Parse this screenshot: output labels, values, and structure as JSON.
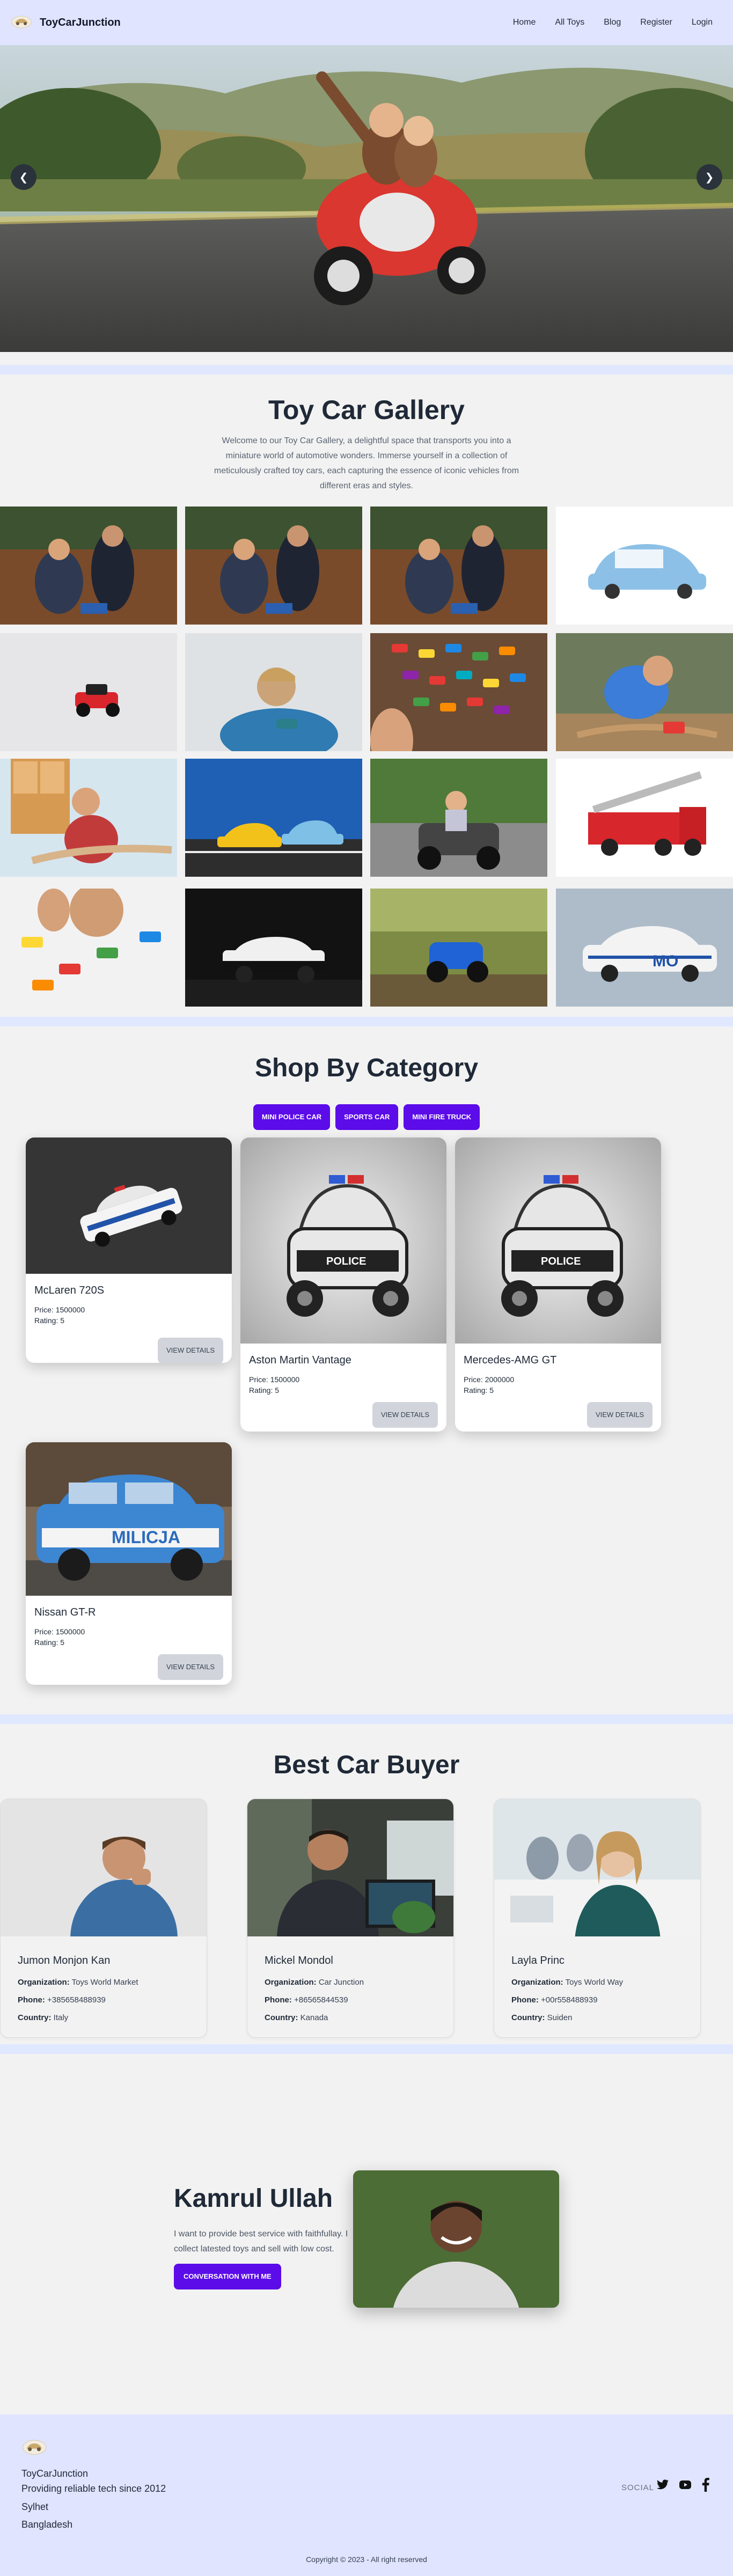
{
  "navbar": {
    "brand": "ToyCarJunction",
    "links": [
      "Home",
      "All Toys",
      "Blog",
      "Register",
      "Login"
    ]
  },
  "hero": {
    "prev": "❮",
    "next": "❯"
  },
  "gallery": {
    "title": "Toy Car Gallery",
    "intro": "Welcome to our Toy Car Gallery, a delightful space that transports you into a miniature world of automotive wonders. Immerse yourself in a collection of meticulously crafted toy cars, each capturing the essence of iconic vehicles from different eras and styles."
  },
  "shop": {
    "title": "Shop By Category",
    "tabs": [
      "MINI POLICE CAR",
      "SPORTS CAR",
      "MINI FIRE TRUCK"
    ],
    "price_label": "Price:",
    "rating_label": "Rating:",
    "details_label": "VIEW DETAILS",
    "products": [
      {
        "name": "McLaren 720S",
        "price": "1500000",
        "rating": "5"
      },
      {
        "name": "Aston Martin Vantage",
        "price": "1500000",
        "rating": "5"
      },
      {
        "name": "Mercedes-AMG GT",
        "price": "2000000",
        "rating": "5"
      },
      {
        "name": "Nissan GT-R",
        "price": "1500000",
        "rating": "5"
      }
    ]
  },
  "buyers": {
    "title": "Best Car Buyer",
    "org_label": "Organization:",
    "phone_label": "Phone:",
    "country_label": "Country:",
    "items": [
      {
        "name": "Jumon Monjon Kan",
        "organization": "Toys World Market",
        "phone": "+385658488939",
        "country": "Italy"
      },
      {
        "name": "Mickel Mondol",
        "organization": "Car Junction",
        "phone": "+86565844539",
        "country": "Kanada"
      },
      {
        "name": "Layla Princ",
        "organization": "Toys World Way",
        "phone": "+00r558488939",
        "country": "Suiden"
      }
    ]
  },
  "owner": {
    "name": "Kamrul Ullah",
    "description": "I want to provide best service with faithfullay. I collect latested toys and sell with low cost.",
    "button": "CONVERSATION WITH ME"
  },
  "footer": {
    "brand": "ToyCarJunction",
    "tagline": "Providing reliable tech since 2012",
    "city": "Sylhet",
    "country": "Bangladesh",
    "social_label": "SOCIAL",
    "copyright": "Copyright © 2023 - All right reserved"
  },
  "colors": {
    "accent": "#5b0ce8",
    "navbar_bg": "#e0e4ff",
    "page_bg": "#f2f2f2"
  }
}
